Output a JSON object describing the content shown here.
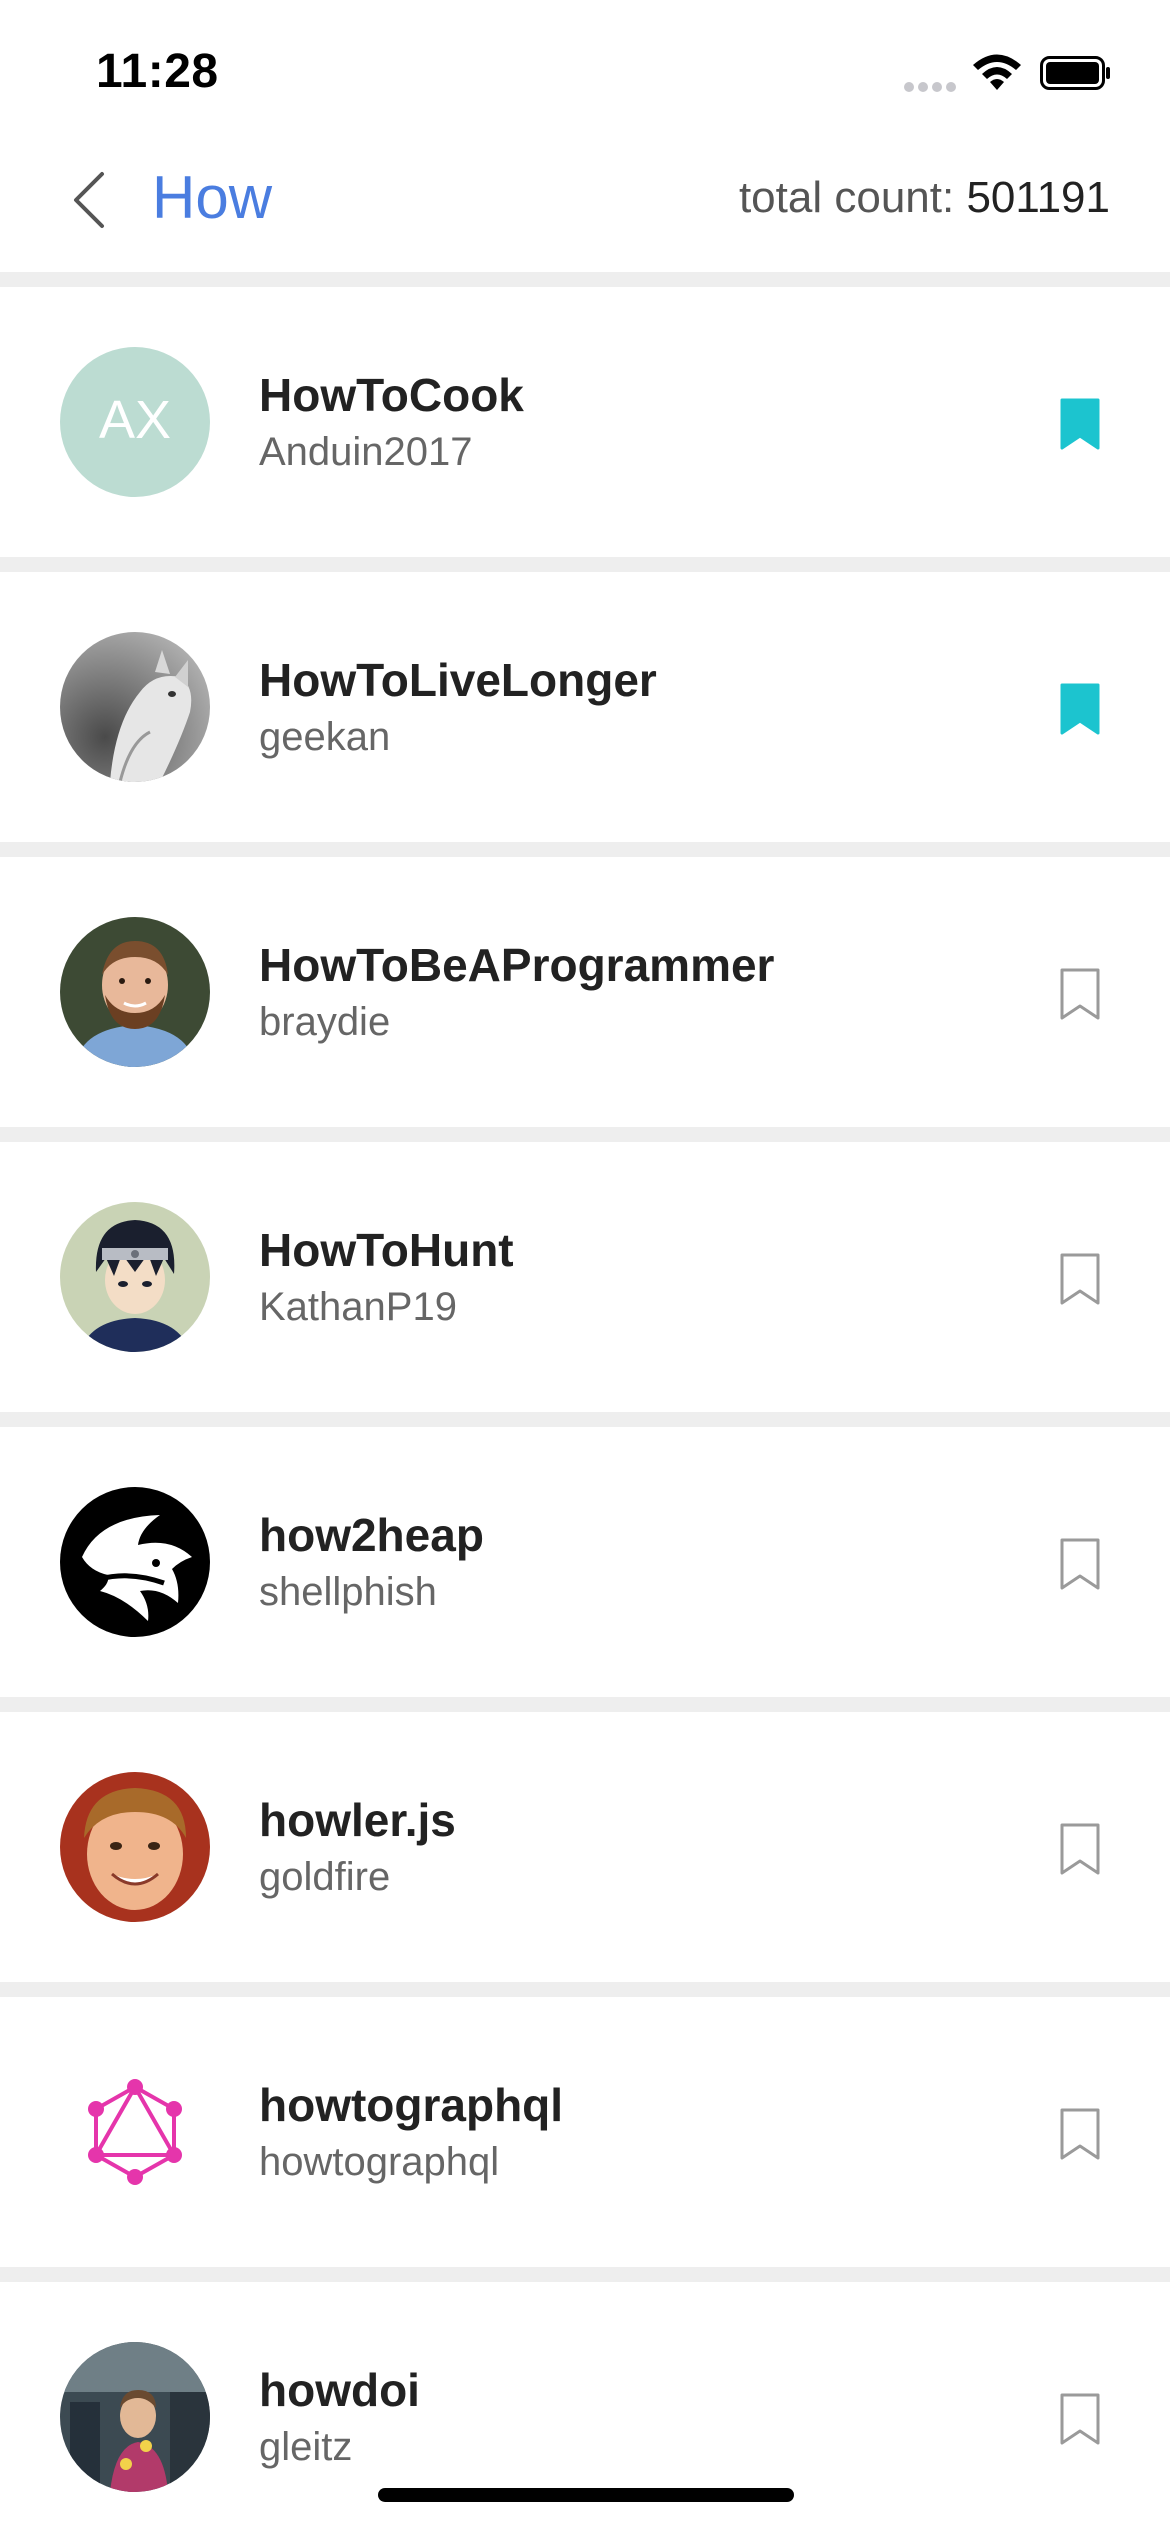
{
  "status_bar": {
    "time": "11:28",
    "icons": [
      "signal-dots-icon",
      "wifi-icon",
      "battery-icon"
    ]
  },
  "nav": {
    "back_icon": "chevron-left-icon",
    "title": "How",
    "count_label": "total count: ",
    "count_value": "501191"
  },
  "colors": {
    "accent": "#4a7de0",
    "bookmark_filled": "#1cc4cf",
    "bookmark_outline": "#9a9a9a",
    "separator": "#eeeeee"
  },
  "repos": [
    {
      "name": "HowToCook",
      "owner": "Anduin2017",
      "avatar_text": "AX",
      "bookmarked": true
    },
    {
      "name": "HowToLiveLonger",
      "owner": "geekan",
      "avatar_text": "",
      "bookmarked": true
    },
    {
      "name": "HowToBeAProgrammer",
      "owner": "braydie",
      "avatar_text": "",
      "bookmarked": false
    },
    {
      "name": "HowToHunt",
      "owner": "KathanP19",
      "avatar_text": "",
      "bookmarked": false
    },
    {
      "name": "how2heap",
      "owner": "shellphish",
      "avatar_text": "",
      "bookmarked": false
    },
    {
      "name": "howler.js",
      "owner": "goldfire",
      "avatar_text": "",
      "bookmarked": false
    },
    {
      "name": "howtographql",
      "owner": "howtographql",
      "avatar_text": "",
      "bookmarked": false
    },
    {
      "name": "howdoi",
      "owner": "gleitz",
      "avatar_text": "",
      "bookmarked": false
    }
  ]
}
